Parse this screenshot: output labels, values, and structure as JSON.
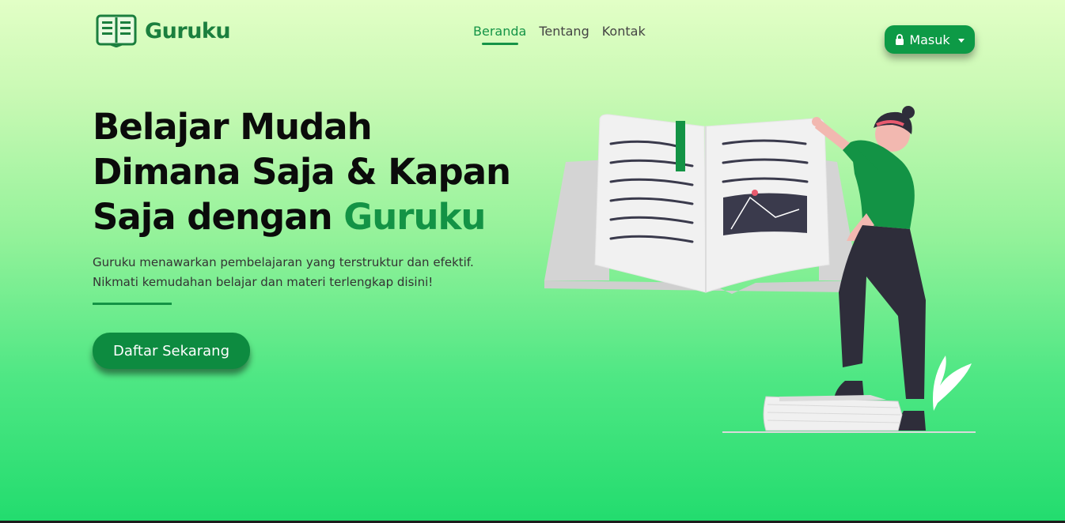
{
  "brand": {
    "name": "Guruku",
    "logo_icon": "book-icon"
  },
  "nav": {
    "items": [
      {
        "label": "Beranda",
        "active": true
      },
      {
        "label": "Tentang",
        "active": false
      },
      {
        "label": "Kontak",
        "active": false
      }
    ]
  },
  "login": {
    "label": "Masuk",
    "icon": "lock-icon"
  },
  "hero": {
    "title_line1": "Belajar Mudah",
    "title_line2": "Dimana Saja & Kapan",
    "title_line3_prefix": "Saja dengan ",
    "title_line3_accent": "Guruku",
    "desc_line1": "Guruku menawarkan pembelajaran yang terstruktur dan efektif.",
    "desc_line2": "Nikmati kemudahan belajar dan materi terlengkap disini!",
    "cta_label": "Daftar Sekarang"
  },
  "colors": {
    "accent": "#139345",
    "button": "#0d9a46",
    "gradient_top": "#e2ffc6",
    "gradient_bottom": "#22dc6e"
  }
}
